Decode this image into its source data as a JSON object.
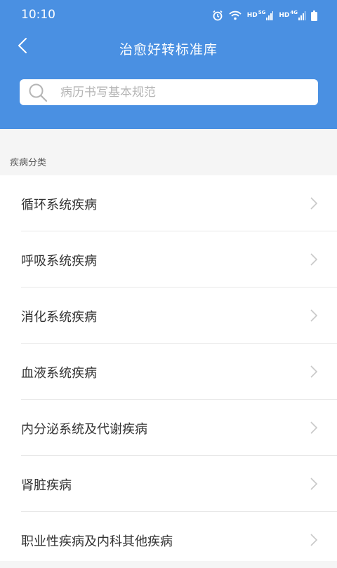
{
  "status_bar": {
    "time": "10:10",
    "net1": "HD",
    "net1_gen": "5G",
    "net2": "HD",
    "net2_gen": "4G",
    "icons": [
      "alarm-icon",
      "wifi-icon",
      "signal-icon",
      "signal-icon",
      "battery-icon"
    ]
  },
  "header": {
    "title": "治愈好转标准库",
    "back_icon": "chevron-left-icon",
    "bg_color": "#4a90e2"
  },
  "search": {
    "placeholder": "病历书写基本规范",
    "icon": "search-icon"
  },
  "section": {
    "label": "疾病分类"
  },
  "list": {
    "items": [
      {
        "label": "循环系统疾病"
      },
      {
        "label": "呼吸系统疾病"
      },
      {
        "label": "消化系统疾病"
      },
      {
        "label": "血液系统疾病"
      },
      {
        "label": "内分泌系统及代谢疾病"
      },
      {
        "label": "肾脏疾病"
      },
      {
        "label": "职业性疾病及内科其他疾病"
      }
    ]
  }
}
